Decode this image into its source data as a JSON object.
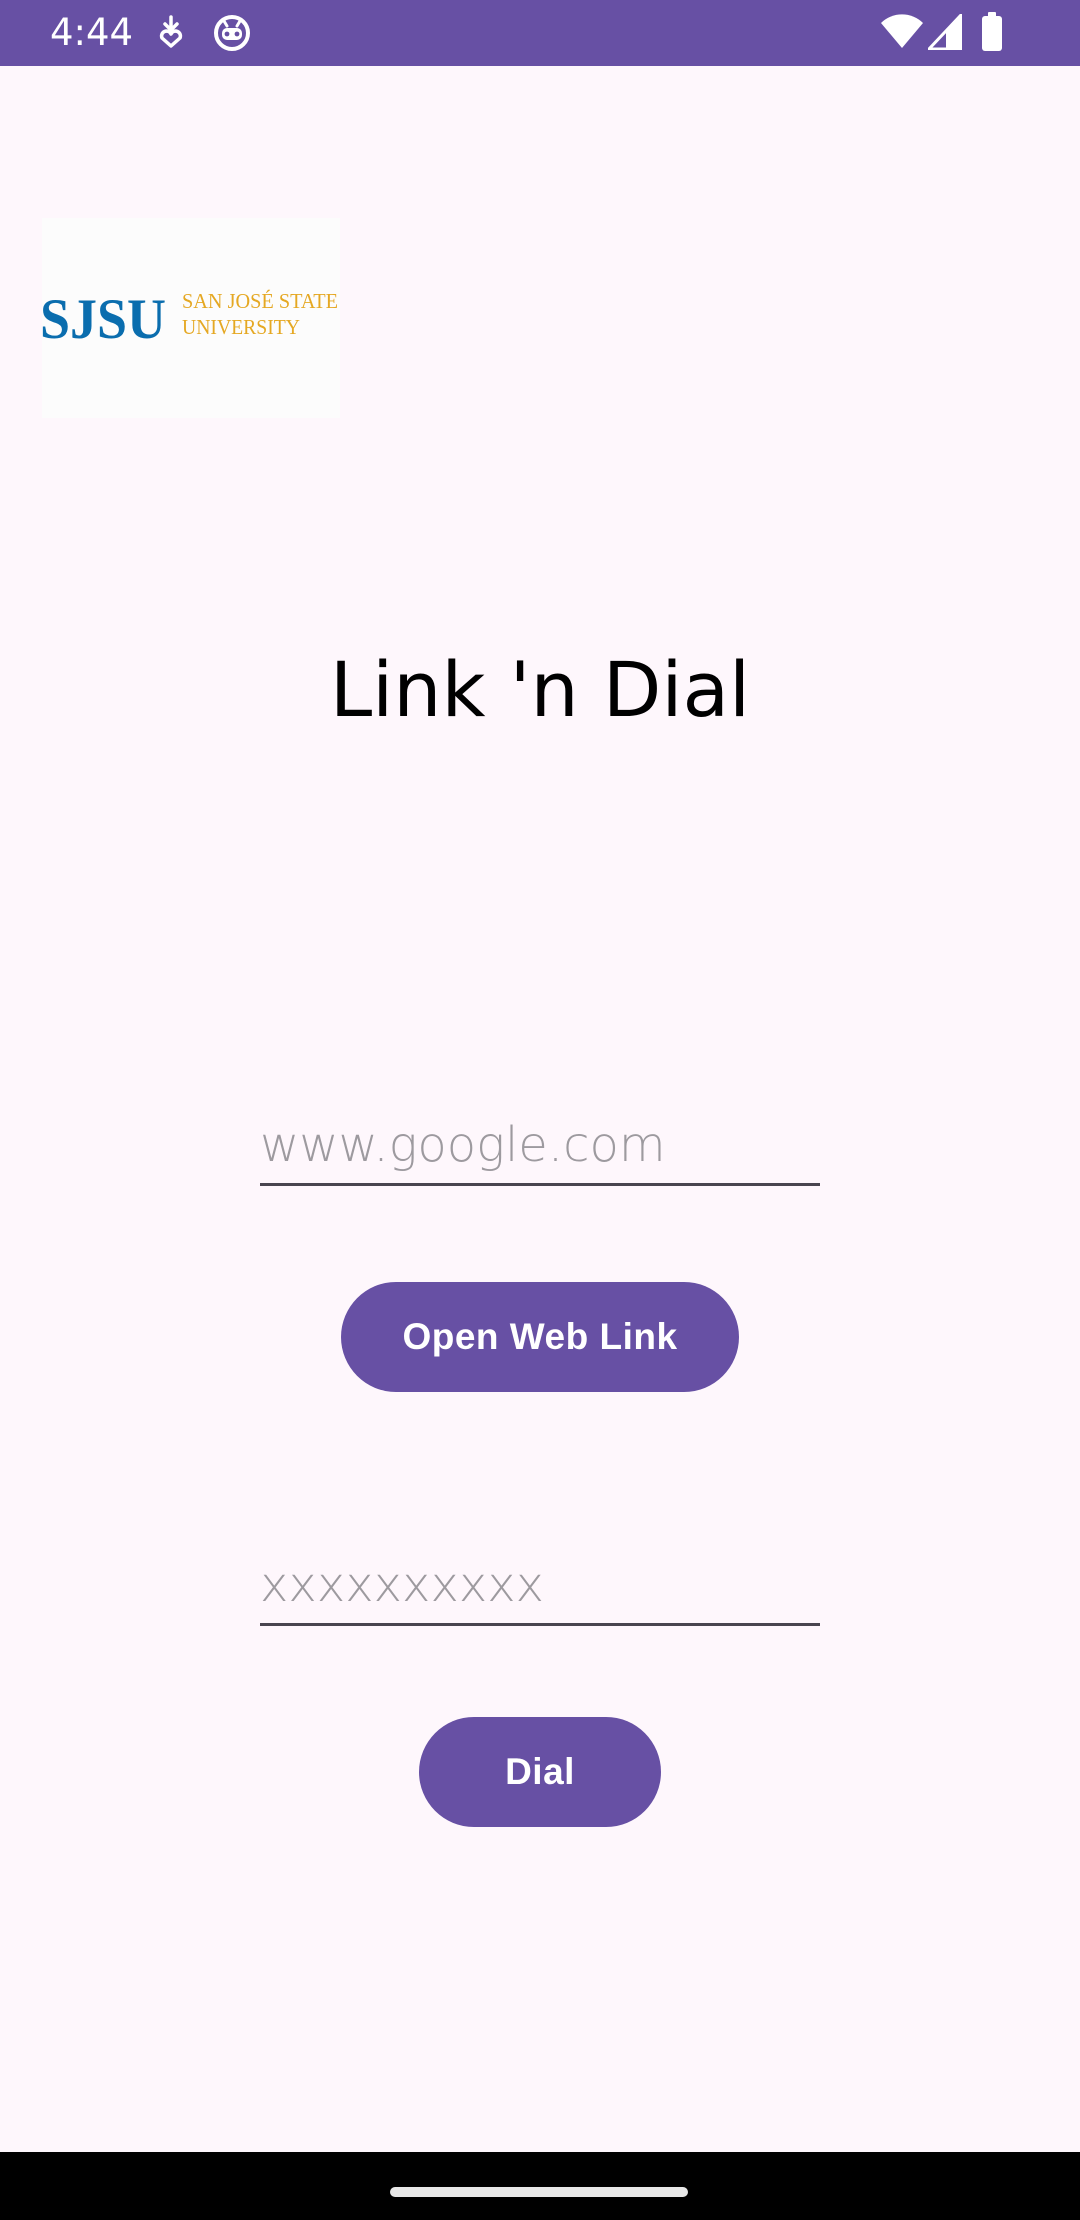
{
  "status_bar": {
    "time": "4:44",
    "background_color": "#6750a4",
    "left_icons": [
      "download-notification-icon",
      "robot-face-icon"
    ],
    "right_icons": [
      "wifi-icon",
      "cellular-signal-icon",
      "battery-icon"
    ]
  },
  "logo": {
    "mark": "SJSU",
    "line1": "SAN JOSÉ STATE",
    "line2": "UNIVERSITY",
    "mark_color": "#0a6dae",
    "text_color": "#e5a823"
  },
  "title": "Link 'n Dial",
  "url_input": {
    "placeholder": "www.google.com",
    "value": ""
  },
  "open_link_button": {
    "label": "Open Web Link"
  },
  "phone_input": {
    "placeholder": "xxxxxxxxxx",
    "value": ""
  },
  "dial_button": {
    "label": "Dial"
  },
  "colors": {
    "accent": "#6750a4",
    "background": "#fef7fc",
    "nav_bar": "#000000"
  }
}
